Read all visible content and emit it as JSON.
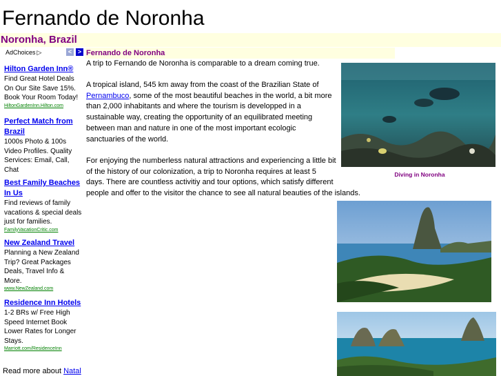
{
  "page": {
    "title": "Fernando de Noronha",
    "subtitle": "Noronha, Brazil",
    "section_heading": "Fernando de Noronha"
  },
  "ads": {
    "adchoices_label": "AdChoices",
    "items": [
      {
        "title": "Hilton Garden Inn®",
        "description": "Find Great Hotel Deals On Our Site Save 15%. Book Your Room Today!",
        "url": "HiltonGardenInn.Hilton.com"
      },
      {
        "title": "Perfect Match from Brazil",
        "description": "1000s Photo & 100s Video Profiles. Quality Services: Email, Call, Chat",
        "url": ""
      },
      {
        "title": "Best Family Beaches In Us",
        "description": "Find reviews of family vacations & special deals just for families.",
        "url": "FamilyVacationCritic.com"
      },
      {
        "title": "New Zealand Travel",
        "description": "Planning a New Zealand Trip? Great Packages Deals, Travel Info & More.",
        "url": "www.NewZealand.com"
      },
      {
        "title": "Residence Inn Hotels",
        "description": "1-2 BRs w/ Free High Speed Internet Book Lower Rates for Longer Stays.",
        "url": "Marriott.com/ResidenceInn"
      }
    ]
  },
  "read_more": {
    "prefix": "Read more about ",
    "link": "Natal"
  },
  "content": {
    "p1": "A trip to Fernando de Noronha is comparable to a dream coming true.",
    "p2_line1": "A tropical island, 545 km away from the coast of the Brazilian State of",
    "p2_link": "Pernambuco",
    "p2_after_link": ", some of the most beautiful beaches in the world, a bit more",
    "p2_line3": "than 2,000 inhabitants and where the tourism is developped in a",
    "p2_line4": "sustainable way, creating the opportunity of an equilibrated meeting",
    "p2_line5": "between man and nature in one of the most important ecologic",
    "p2_line6": "sanctuaries of the world.",
    "p3_line1": "For enjoying the numberless natural attractions and experiencing a little bit",
    "p3_line2": "of the history of our colonization, a trip to Noronha requires at least 5",
    "p3_line3": "days. There are countless activitiy and tour options, which satisfy different",
    "p3_line4": "people and offer to the visitor the chance to see all natural beauties of the islands.",
    "photo1_caption": "Diving in Noronha"
  },
  "colors": {
    "highlight_bg": "#ffffe0",
    "heading_purple": "#800080",
    "link_blue": "#0000ee",
    "url_green": "#008000"
  }
}
